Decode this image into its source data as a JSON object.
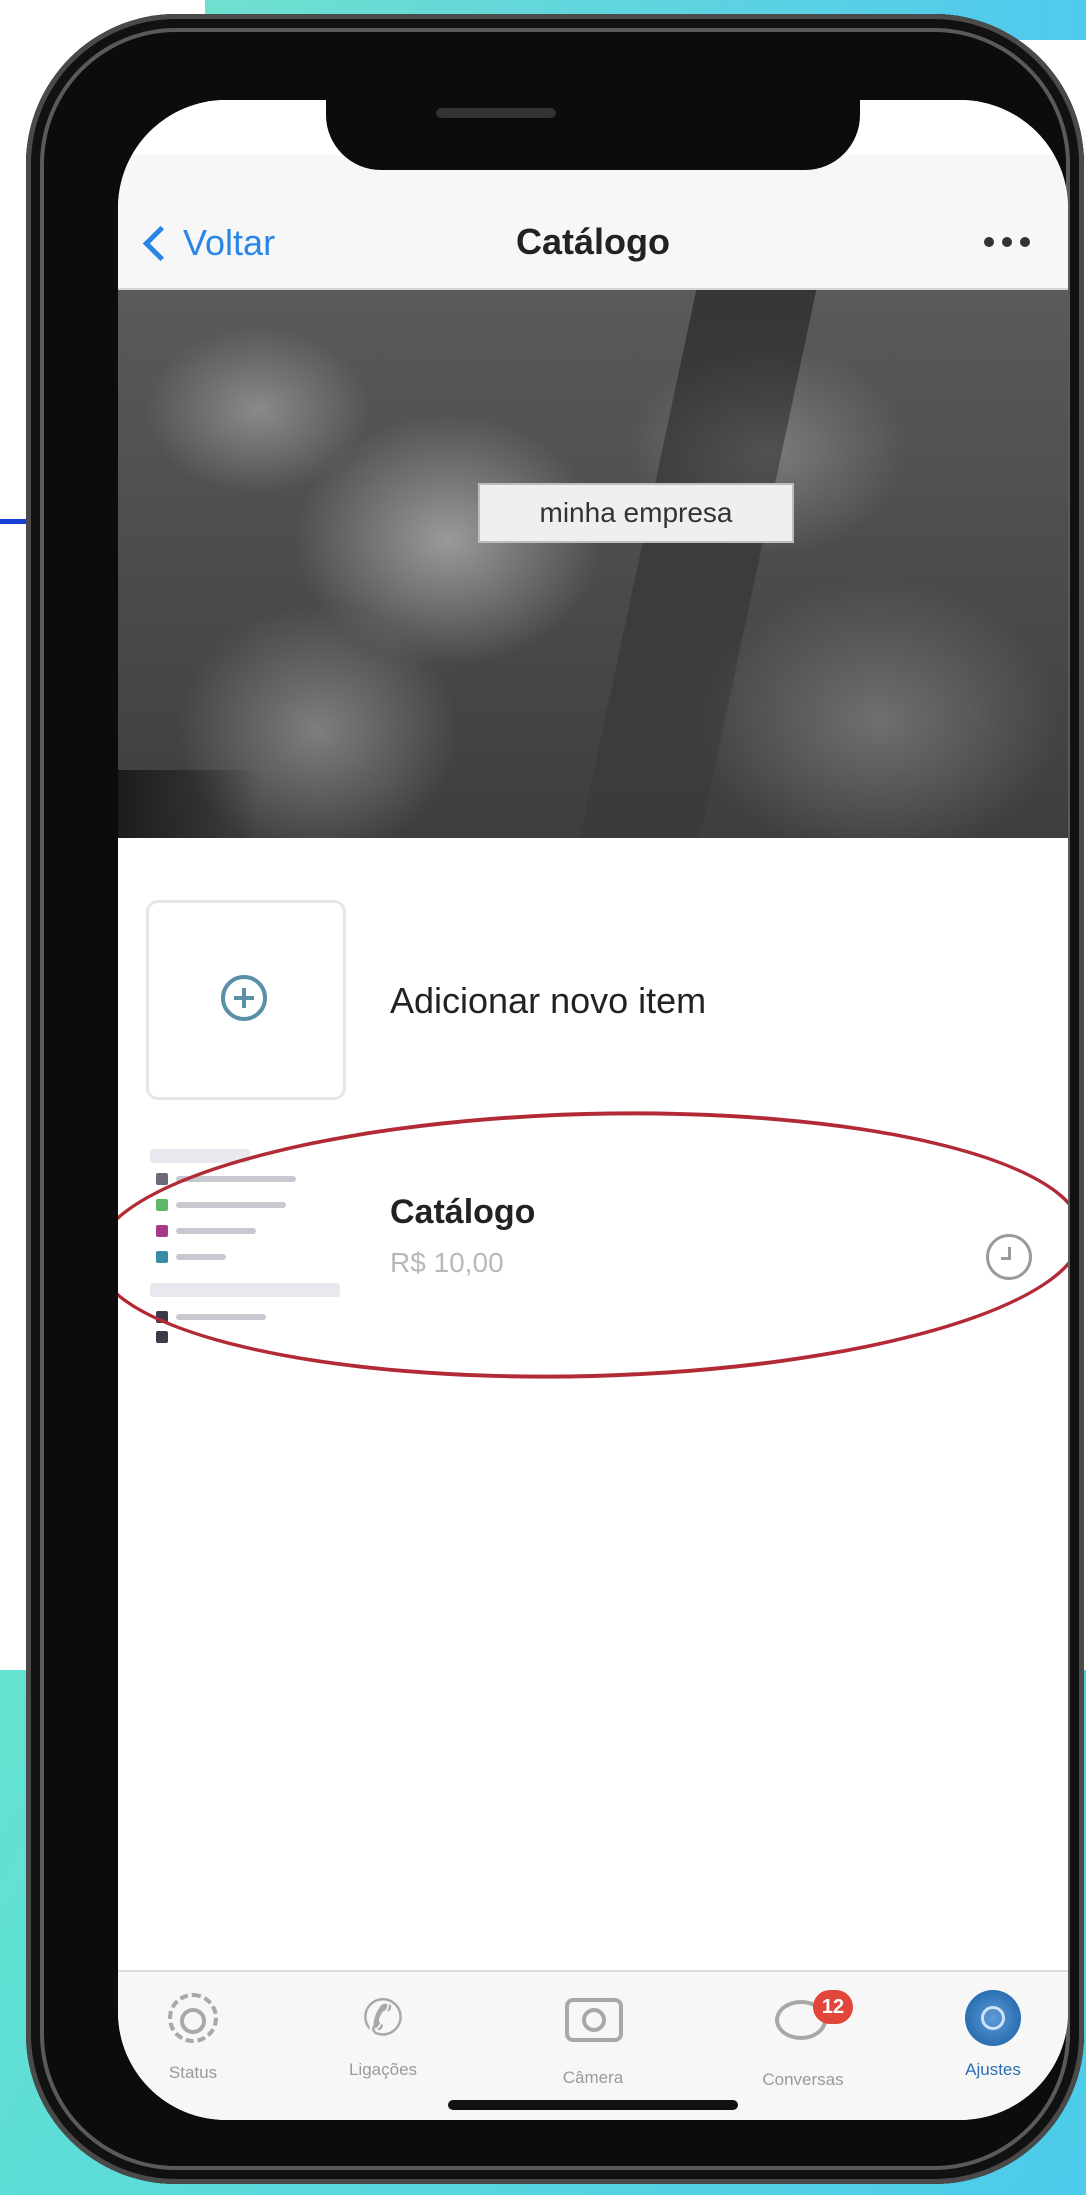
{
  "nav": {
    "back_label": "Voltar",
    "title": "Catálogo"
  },
  "hero": {
    "business_name": "minha empresa"
  },
  "catalog": {
    "add_item_label": "Adicionar novo item",
    "items": [
      {
        "title": "Catálogo",
        "price": "R$ 10,00"
      }
    ]
  },
  "tabbar": {
    "tabs": [
      {
        "label": "Status",
        "icon": "status-icon"
      },
      {
        "label": "Ligações",
        "icon": "phone-icon"
      },
      {
        "label": "Câmera",
        "icon": "camera-icon"
      },
      {
        "label": "Conversas",
        "icon": "chat-icon",
        "badge": "12"
      },
      {
        "label": "Ajustes",
        "icon": "settings-icon",
        "active": true
      }
    ]
  },
  "colors": {
    "accent": "#2a86e6",
    "highlight_ellipse": "#b22a36",
    "badge": "#e2453a",
    "background_teal": "#64e3d1"
  }
}
